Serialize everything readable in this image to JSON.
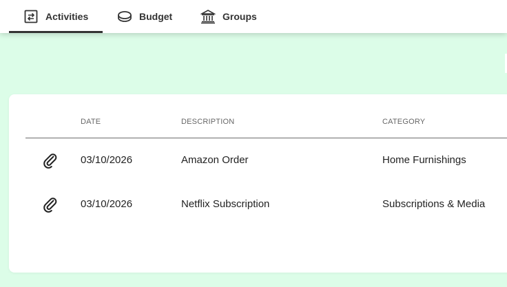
{
  "nav": {
    "tabs": [
      {
        "label": "Activities",
        "icon": "transfer-icon",
        "active": true
      },
      {
        "label": "Budget",
        "icon": "coin-icon",
        "active": false
      },
      {
        "label": "Groups",
        "icon": "bank-icon",
        "active": false
      }
    ]
  },
  "table": {
    "columns": [
      "DATE",
      "DESCRIPTION",
      "CATEGORY"
    ],
    "rows": [
      {
        "attachment_icon": "paperclip-icon",
        "date": "03/10/2026",
        "description": "Amazon Order",
        "category": "Home Furnishings"
      },
      {
        "attachment_icon": "paperclip-icon",
        "date": "03/10/2026",
        "description": "Netflix Subscription",
        "category": "Subscriptions & Media"
      }
    ]
  },
  "colors": {
    "background": "#dcfde8",
    "surface": "#ffffff",
    "text": "#222222",
    "muted": "#666666",
    "active_tab_indicator": "#333333"
  }
}
